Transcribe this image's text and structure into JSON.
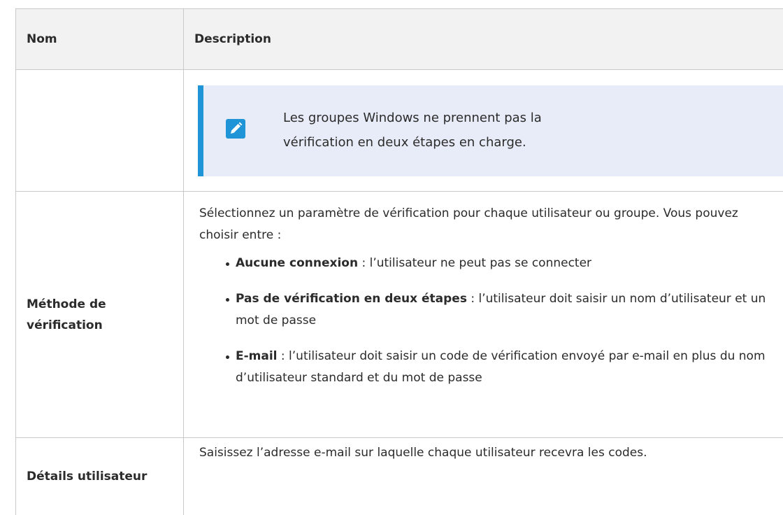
{
  "table": {
    "headers": {
      "name": "Nom",
      "description": "Description"
    },
    "note": {
      "icon": "pencil-icon",
      "accent_color": "#1f95d8",
      "background_color": "#e8ecf8",
      "line1": "Les groupes Windows ne prennent pas la",
      "line2": "vérification en deux étapes en charge."
    },
    "rows": [
      {
        "name_line1": "Méthode de",
        "name_line2": "vérification",
        "intro": "Sélectionnez un paramètre de vérification pour chaque utilisateur ou groupe. Vous pouvez choisir entre :",
        "options": [
          {
            "term": "Aucune connexion",
            "text": " : l’utilisateur ne peut pas se connecter"
          },
          {
            "term": "Pas de vérification en deux étapes",
            "text": " : l’utilisateur doit saisir un nom d’utilisateur et un mot de passe"
          },
          {
            "term": "E-mail",
            "text": " : l’utilisateur doit saisir un code de vérification envoyé par e-mail en plus du nom d’utilisateur standard et du mot de passe"
          }
        ]
      },
      {
        "name": "Détails utilisateur",
        "description": "Saisissez l’adresse e-mail sur laquelle chaque utilisateur recevra les codes."
      }
    ]
  }
}
